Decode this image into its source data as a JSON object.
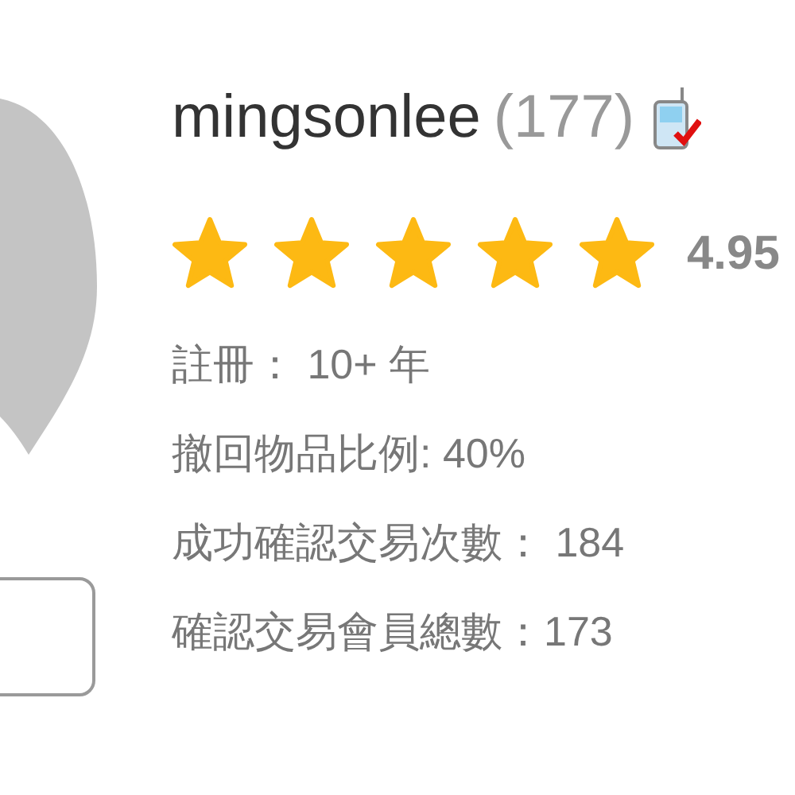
{
  "profile": {
    "username": "mingsonlee",
    "feedback_count": "(177)",
    "phone_verified": true,
    "stars": 5,
    "rating": "4.95",
    "details": [
      {
        "text": "註冊： 10+ 年"
      },
      {
        "text": "撤回物品比例: 40%"
      },
      {
        "text": "成功確認交易次數： 184"
      },
      {
        "text": "確認交易會員總數：173"
      }
    ]
  }
}
